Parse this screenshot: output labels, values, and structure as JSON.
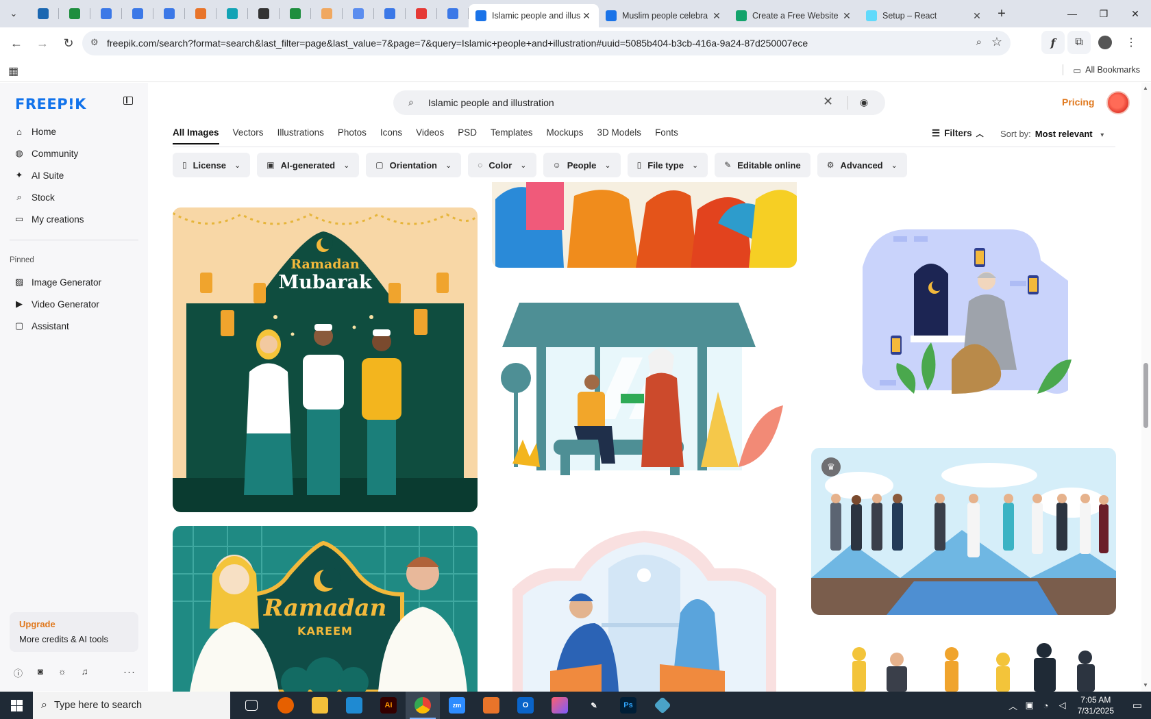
{
  "browser": {
    "tabs": [
      {
        "label": "Islamic people and illus",
        "active": true,
        "favicon_color": "#1a73e8"
      },
      {
        "label": "Muslim people celebra",
        "active": false,
        "favicon_color": "#1a73e8"
      },
      {
        "label": "Create a Free Website |",
        "active": false,
        "favicon_color": "#13a36b"
      },
      {
        "label": "Setup – React",
        "active": false,
        "favicon_color": "#61dafb"
      }
    ],
    "pinned_favicons": [
      "#1b67b1",
      "#1e8e3e",
      "#3b78e7",
      "#3b78e7",
      "#3b78e7",
      "#e8742a",
      "#12a3b5",
      "#333333",
      "#1e8e3e",
      "#f0a860",
      "#5b8def",
      "#3b78e7",
      "#e53935",
      "#3b78e7"
    ],
    "url": "freepik.com/search?format=search&last_filter=page&last_value=7&page=7&query=Islamic+people+and+illustration#uuid=5085b404-b3cb-416a-9a24-87d250007ece",
    "all_bookmarks": "All Bookmarks"
  },
  "sidebar": {
    "logo": "FREEP!K",
    "nav": [
      {
        "label": "Home",
        "icon": "home-icon",
        "glyph": "⌂"
      },
      {
        "label": "Community",
        "icon": "globe-icon",
        "glyph": "◍"
      },
      {
        "label": "AI Suite",
        "icon": "sparkle-icon",
        "glyph": "✦"
      },
      {
        "label": "Stock",
        "icon": "search-icon",
        "glyph": "⌕"
      },
      {
        "label": "My creations",
        "icon": "folder-icon",
        "glyph": "▭"
      }
    ],
    "pinned_label": "Pinned",
    "pinned": [
      {
        "label": "Image Generator",
        "icon": "image-icon",
        "glyph": "▨"
      },
      {
        "label": "Video Generator",
        "icon": "video-icon",
        "glyph": "▶"
      },
      {
        "label": "Assistant",
        "icon": "chat-icon",
        "glyph": "▢"
      }
    ],
    "upgrade_title": "Upgrade",
    "upgrade_sub": "More credits & AI tools"
  },
  "header": {
    "search_value": "Islamic people and illustration",
    "pricing": "Pricing"
  },
  "type_tabs": [
    "All Images",
    "Vectors",
    "Illustrations",
    "Photos",
    "Icons",
    "Videos",
    "PSD",
    "Templates",
    "Mockups",
    "3D Models",
    "Fonts"
  ],
  "filters_label": "Filters",
  "sort_label": "Sort by:",
  "sort_value": "Most relevant",
  "chips": [
    {
      "label": "License",
      "glyph": "▯",
      "caret": true
    },
    {
      "label": "AI-generated",
      "glyph": "▣",
      "caret": true
    },
    {
      "label": "Orientation",
      "glyph": "▢",
      "caret": true
    },
    {
      "label": "Color",
      "glyph": "◌",
      "caret": true
    },
    {
      "label": "People",
      "glyph": "☺",
      "caret": true
    },
    {
      "label": "File type",
      "glyph": "▯",
      "caret": true
    },
    {
      "label": "Editable online",
      "glyph": "✎",
      "caret": false
    },
    {
      "label": "Advanced",
      "glyph": "⚙",
      "caret": true
    }
  ],
  "art": {
    "ramadan_mubarak_1": "Ramadan",
    "ramadan_mubarak_2": "Mubarak",
    "ramadan_kareem_1": "Ramadan",
    "ramadan_kareem_2": "KAREEM"
  },
  "taskbar": {
    "search_placeholder": "Type here to search",
    "time": "7:05 AM",
    "date": "7/31/2025"
  },
  "colors": {
    "brand": "#1273eb",
    "accent": "#e0781d"
  }
}
